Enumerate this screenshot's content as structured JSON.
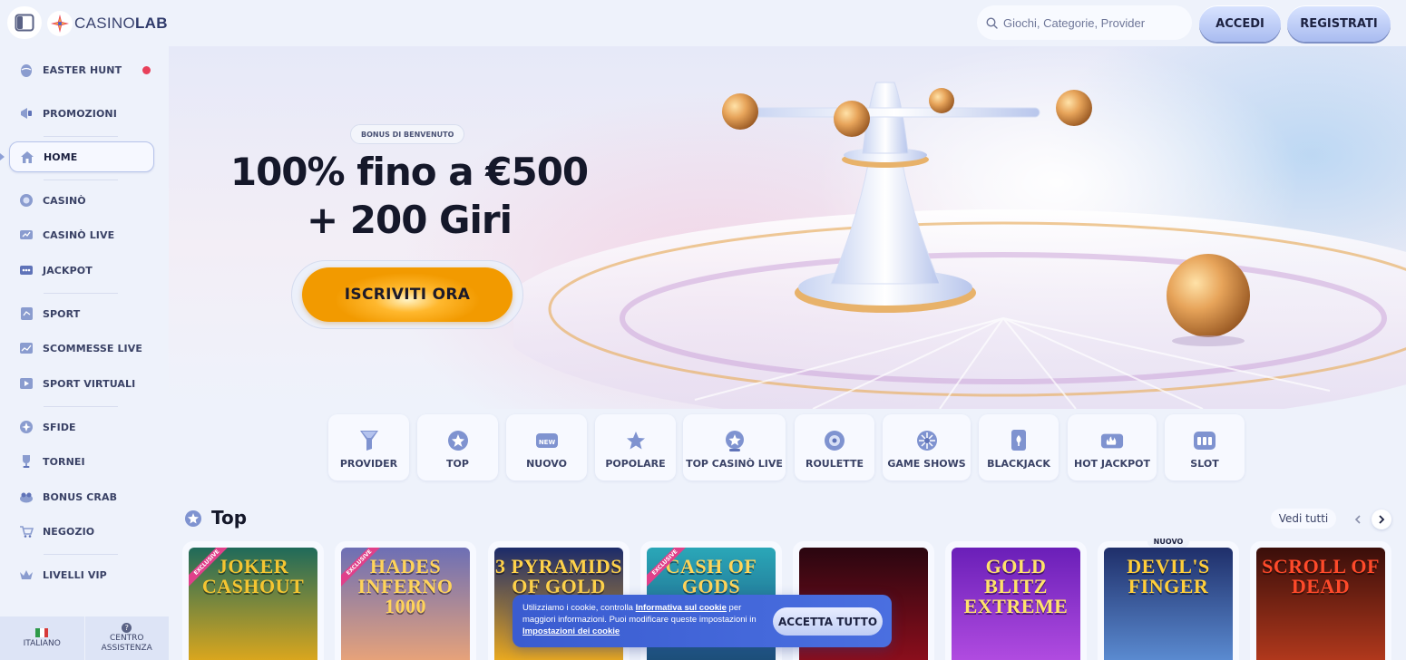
{
  "header": {
    "logo_text_a": "CASINO",
    "logo_text_b": "LAB",
    "search_placeholder": "Giochi, Categorie, Provider",
    "login_label": "ACCEDI",
    "register_label": "REGISTRATI"
  },
  "sidebar": {
    "items": [
      {
        "label": "EASTER HUNT",
        "icon": "egg-icon"
      },
      {
        "label": "PROMOZIONI",
        "icon": "megaphone-icon"
      },
      {
        "label": "HOME",
        "icon": "home-icon",
        "active": true
      },
      {
        "label": "CASINÒ",
        "icon": "chip-icon"
      },
      {
        "label": "CASINÒ LIVE",
        "icon": "live-camera-icon"
      },
      {
        "label": "JACKPOT",
        "icon": "jackpot-icon"
      },
      {
        "label": "SPORT",
        "icon": "sport-icon"
      },
      {
        "label": "SCOMMESSE LIVE",
        "icon": "live-bet-icon"
      },
      {
        "label": "SPORT VIRTUALI",
        "icon": "virtual-sport-icon"
      },
      {
        "label": "SFIDE",
        "icon": "challenge-icon"
      },
      {
        "label": "TORNEI",
        "icon": "trophy-icon"
      },
      {
        "label": "BONUS CRAB",
        "icon": "claw-icon"
      },
      {
        "label": "NEGOZIO",
        "icon": "cart-icon"
      },
      {
        "label": "LIVELLI VIP",
        "icon": "crown-icon"
      }
    ],
    "footer": {
      "language": "ITALIANO",
      "help_line1": "CENTRO",
      "help_line2": "ASSISTENZA"
    }
  },
  "hero": {
    "badge": "BONUS DI BENVENUTO",
    "title_line1": "100% fino a €500",
    "title_line2": "+ 200 Giri",
    "cta": "ISCRIVITI ORA"
  },
  "categories": [
    {
      "label": "PROVIDER",
      "icon": "provider-icon"
    },
    {
      "label": "TOP",
      "icon": "star-badge-icon"
    },
    {
      "label": "NUOVO",
      "icon": "new-icon"
    },
    {
      "label": "POPOLARE",
      "icon": "star-icon"
    },
    {
      "label": "TOP CASINÒ LIVE",
      "icon": "live-star-icon"
    },
    {
      "label": "ROULETTE",
      "icon": "roulette-icon"
    },
    {
      "label": "GAME SHOWS",
      "icon": "wheel-icon"
    },
    {
      "label": "BLACKJACK",
      "icon": "card-icon"
    },
    {
      "label": "HOT JACKPOT",
      "icon": "hot-jackpot-icon"
    },
    {
      "label": "SLOT",
      "icon": "slot-icon"
    }
  ],
  "top_section": {
    "title": "Top",
    "see_all": "Vedi tutti",
    "new_tag": "NUOVO",
    "games": [
      {
        "title": "JOKER CASHOUT",
        "ribbon": "EXCLUSIVE",
        "color_a": "#1f6a5a",
        "color_b": "#d9a61e",
        "text_color": "#f5c531"
      },
      {
        "title": "HADES INFERNO 1000",
        "ribbon": "EXCLUSIVE",
        "color_a": "#6d6fb5",
        "color_b": "#e6a27a",
        "text_color": "#ffd45a"
      },
      {
        "title": "3 PYRAMIDS OF GOLD",
        "ribbon": "",
        "color_a": "#1b2a6a",
        "color_b": "#e8a820",
        "text_color": "#ffd24a"
      },
      {
        "title": "CASH OF GODS",
        "ribbon": "EXCLUSIVE",
        "color_a": "#2aa7b8",
        "color_b": "#1d4f7a",
        "text_color": "#ffd45a"
      },
      {
        "title": "",
        "ribbon": "",
        "color_a": "#2a0610",
        "color_b": "#8a0e1c",
        "text_color": "#ff6a3a"
      },
      {
        "title": "GOLD BLITZ EXTREME",
        "ribbon": "",
        "color_a": "#6a1fb8",
        "color_b": "#b04be0",
        "text_color": "#ffe36a"
      },
      {
        "title": "DEVIL'S FINGER",
        "ribbon": "",
        "color_a": "#1f2f6a",
        "color_b": "#5a8ad0",
        "text_color": "#ffce3a"
      },
      {
        "title": "SCROLL OF DEAD",
        "ribbon": "",
        "color_a": "#3a0e0a",
        "color_b": "#b0381c",
        "text_color": "#ff4a2a"
      }
    ]
  },
  "cookie": {
    "text_a": "Utilizziamo i cookie, controlla ",
    "link_a": "Informativa sul cookie",
    "text_b": " per maggiori informazioni. Puoi modificare queste impostazioni in ",
    "link_b": "Impostazioni dei cookie",
    "accept": "ACCETTA TUTTO"
  }
}
